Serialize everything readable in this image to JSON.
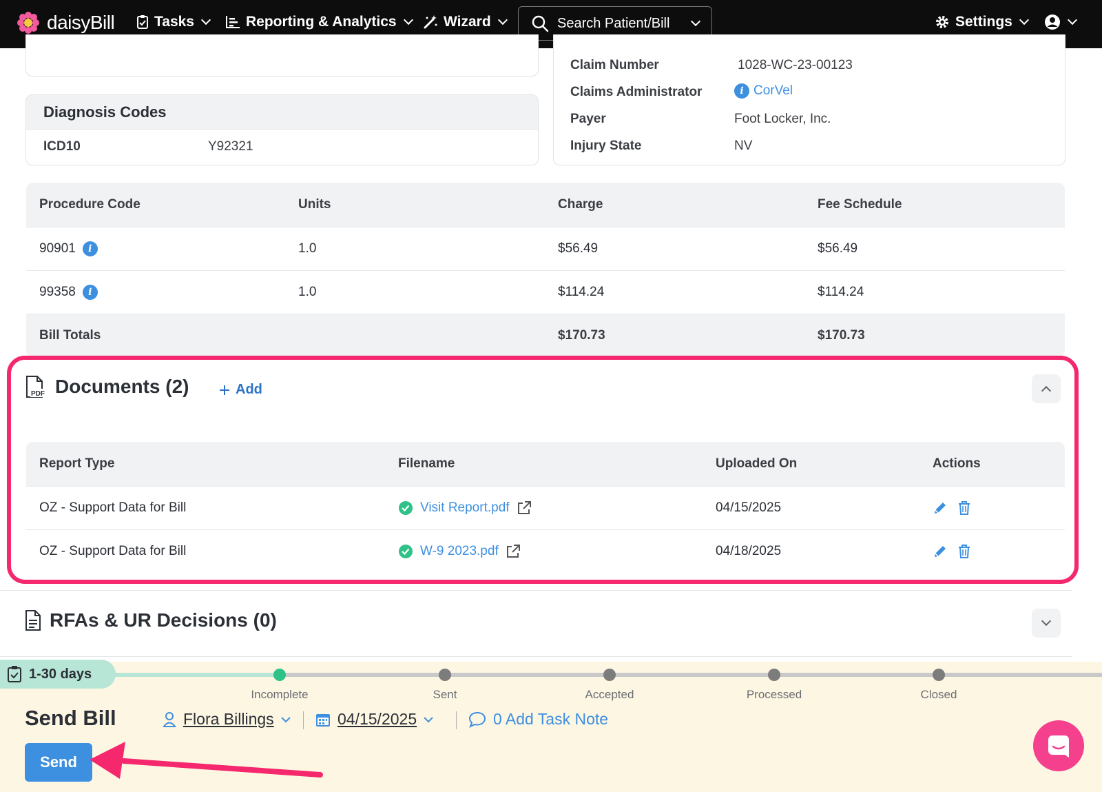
{
  "nav": {
    "brand": "daisyBill",
    "tasks": "Tasks",
    "reporting": "Reporting & Analytics",
    "wizard": "Wizard",
    "search_placeholder": "Search Patient/Bill",
    "settings": "Settings"
  },
  "diagnosis": {
    "title": "Diagnosis Codes",
    "code_type": "ICD10",
    "code": "Y92321"
  },
  "claim": {
    "claim_number_label": "Claim Number",
    "claim_number": "1028-WC-23-00123",
    "admin_label": "Claims Administrator",
    "admin": "CorVel",
    "payer_label": "Payer",
    "payer": "Foot Locker, Inc.",
    "state_label": "Injury State",
    "state": "NV"
  },
  "procedures": {
    "headers": [
      "Procedure Code",
      "Units",
      "Charge",
      "Fee Schedule"
    ],
    "rows": [
      {
        "code": "90901",
        "units": "1.0",
        "charge": "$56.49",
        "fee": "$56.49"
      },
      {
        "code": "99358",
        "units": "1.0",
        "charge": "$114.24",
        "fee": "$114.24"
      }
    ],
    "totals_label": "Bill Totals",
    "total_charge": "$170.73",
    "total_fee": "$170.73"
  },
  "documents": {
    "title": "Documents (2)",
    "add_label": "Add",
    "headers": [
      "Report Type",
      "Filename",
      "Uploaded On",
      "Actions"
    ],
    "rows": [
      {
        "type": "OZ - Support Data for Bill",
        "file": "Visit Report.pdf",
        "date": "04/15/2025"
      },
      {
        "type": "OZ - Support Data for Bill",
        "file": "W-9 2023.pdf",
        "date": "04/18/2025"
      }
    ]
  },
  "rfa": {
    "title": "RFAs & UR Decisions (0)"
  },
  "workflow": {
    "days": "1-30 days",
    "steps": [
      "Incomplete",
      "Sent",
      "Accepted",
      "Processed",
      "Closed"
    ],
    "title": "Send Bill",
    "assignee": "Flora Billings",
    "date": "04/15/2025",
    "task_note": "0 Add Task Note",
    "send_label": "Send"
  },
  "colors": {
    "highlight": "#f5286e",
    "accent": "#3d8fe0",
    "success": "#2fc288"
  }
}
